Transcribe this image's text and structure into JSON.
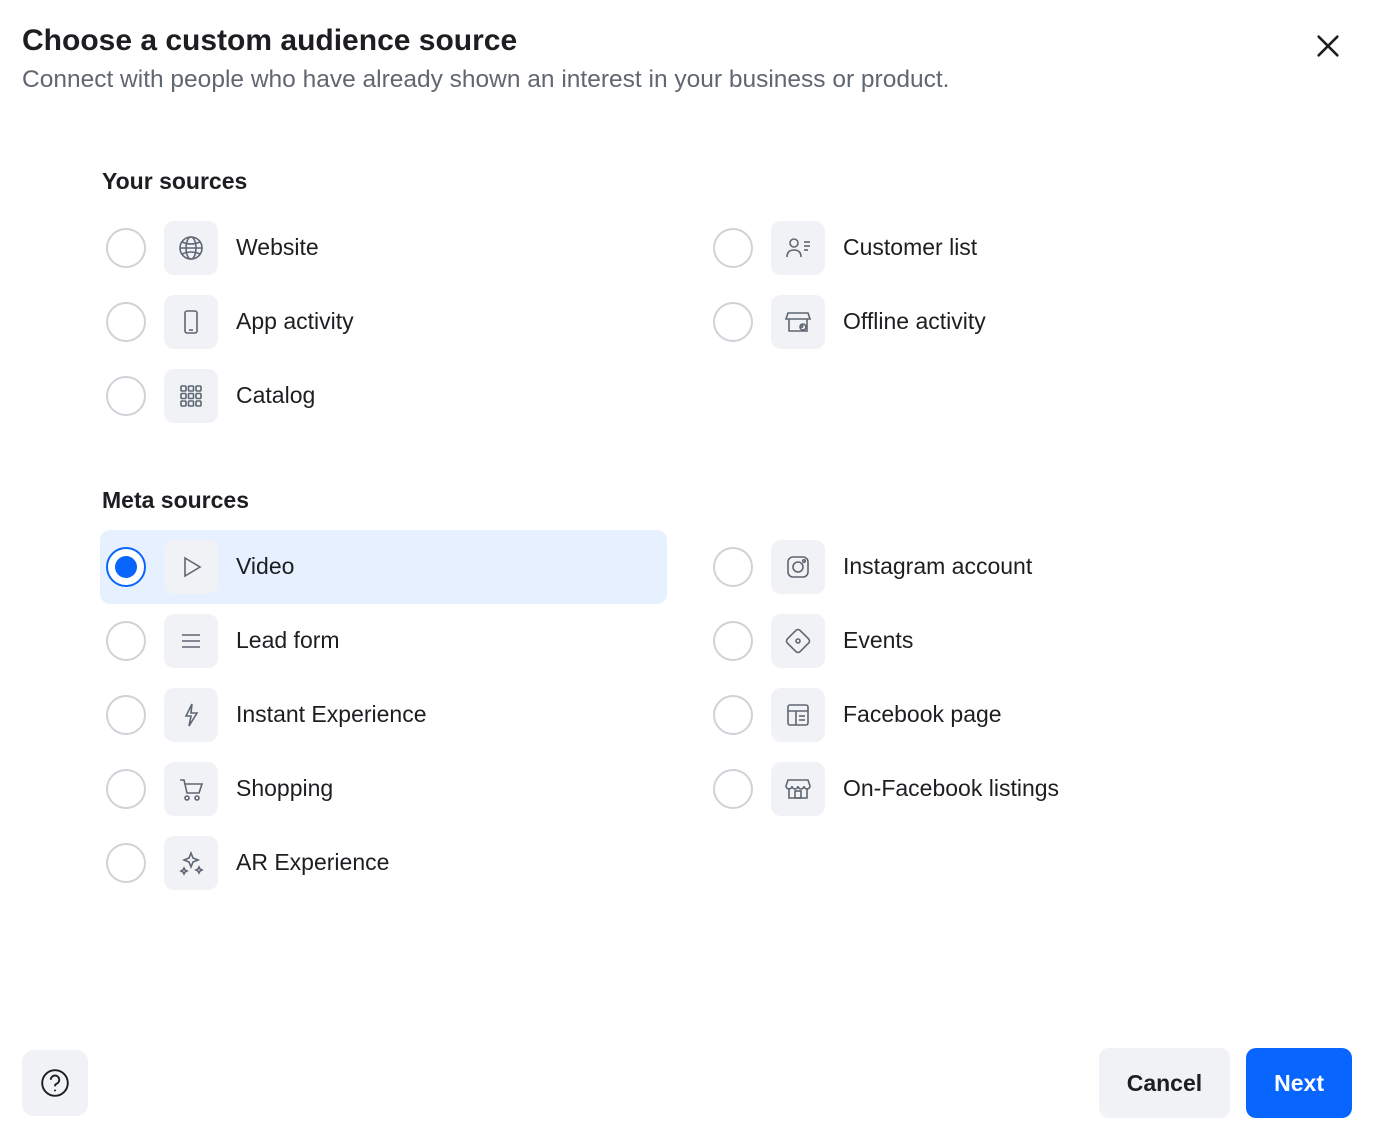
{
  "header": {
    "title": "Choose a custom audience source",
    "subtitle": "Connect with people who have already shown an interest in your business or product."
  },
  "sections": {
    "your_sources": {
      "title": "Your sources",
      "items": [
        {
          "id": "website",
          "label": "Website",
          "icon": "globe-icon",
          "selected": false
        },
        {
          "id": "customer-list",
          "label": "Customer list",
          "icon": "customer-list-icon",
          "selected": false
        },
        {
          "id": "app-activity",
          "label": "App activity",
          "icon": "mobile-icon",
          "selected": false
        },
        {
          "id": "offline-activity",
          "label": "Offline activity",
          "icon": "store-icon",
          "selected": false
        },
        {
          "id": "catalog",
          "label": "Catalog",
          "icon": "catalog-grid-icon",
          "selected": false
        }
      ]
    },
    "meta_sources": {
      "title": "Meta sources",
      "items": [
        {
          "id": "video",
          "label": "Video",
          "icon": "play-icon",
          "selected": true
        },
        {
          "id": "instagram-account",
          "label": "Instagram account",
          "icon": "instagram-icon",
          "selected": false
        },
        {
          "id": "lead-form",
          "label": "Lead form",
          "icon": "form-lines-icon",
          "selected": false
        },
        {
          "id": "events",
          "label": "Events",
          "icon": "ticket-icon",
          "selected": false
        },
        {
          "id": "instant-experience",
          "label": "Instant Experience",
          "icon": "lightning-icon",
          "selected": false
        },
        {
          "id": "facebook-page",
          "label": "Facebook page",
          "icon": "page-layout-icon",
          "selected": false
        },
        {
          "id": "shopping",
          "label": "Shopping",
          "icon": "cart-icon",
          "selected": false
        },
        {
          "id": "on-facebook-listings",
          "label": "On-Facebook listings",
          "icon": "storefront-icon",
          "selected": false
        },
        {
          "id": "ar-experience",
          "label": "AR Experience",
          "icon": "sparkle-icon",
          "selected": false
        }
      ]
    }
  },
  "footer": {
    "cancel": "Cancel",
    "next": "Next"
  },
  "icons": {
    "close-icon": "close",
    "help-icon": "help"
  }
}
